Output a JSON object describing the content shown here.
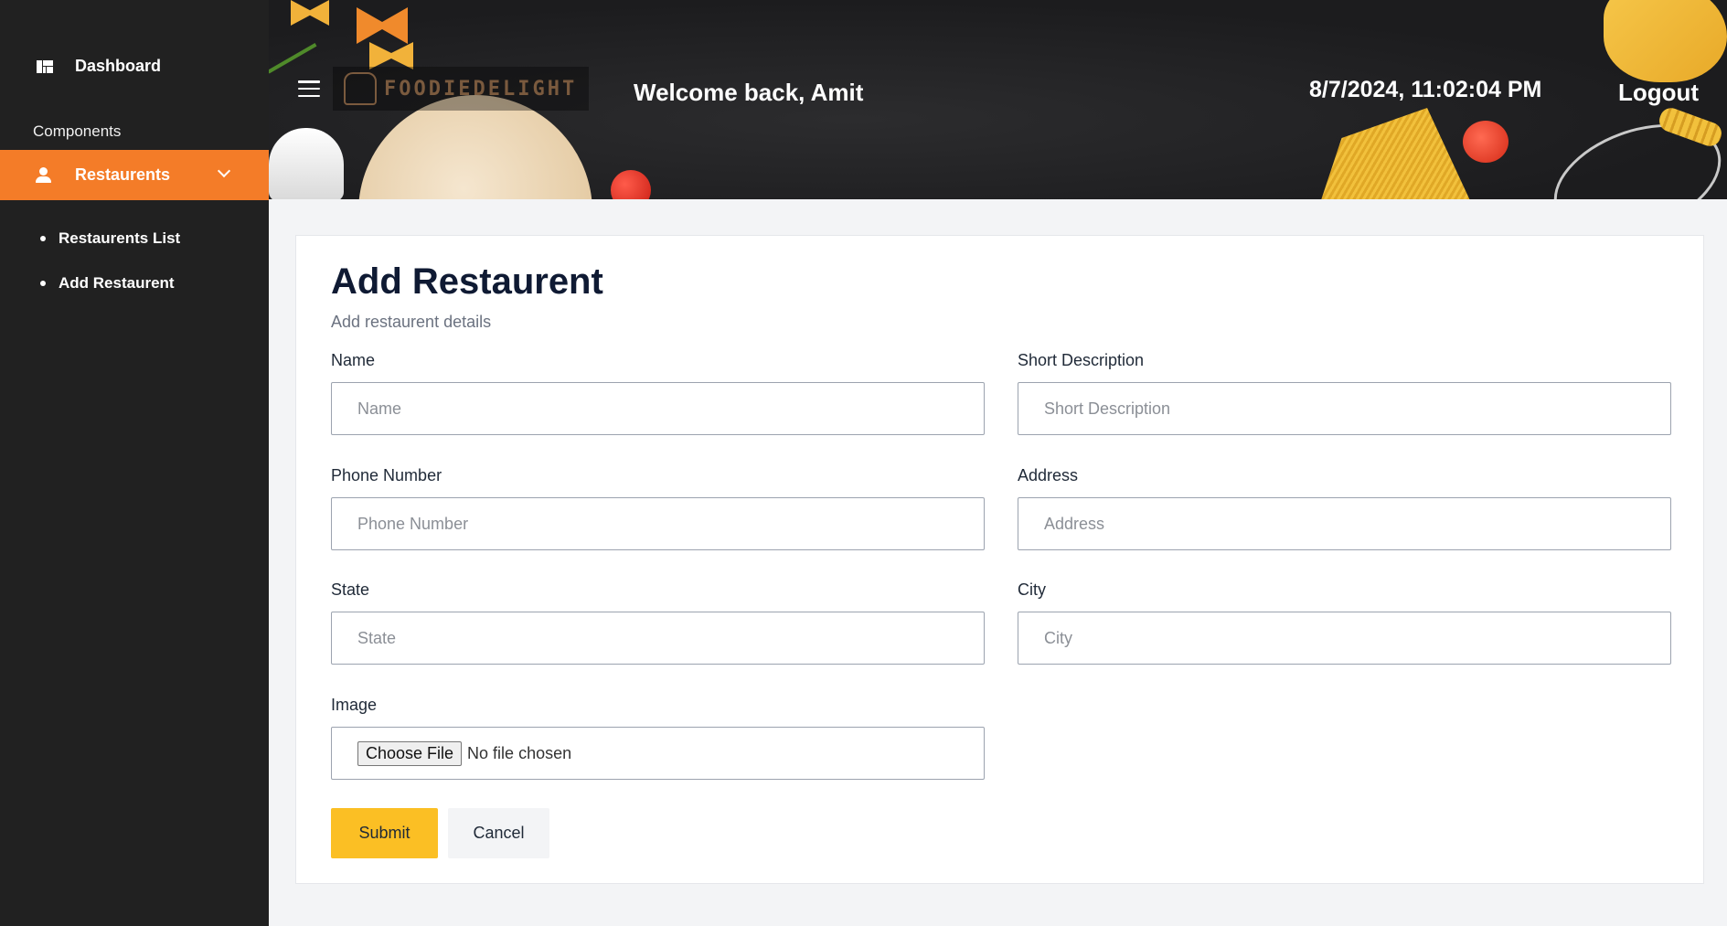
{
  "sidebar": {
    "dashboard_label": "Dashboard",
    "section_label": "Components",
    "restaurants_label": "Restaurents",
    "items": [
      {
        "label": "Restaurents List"
      },
      {
        "label": "Add Restaurent"
      }
    ],
    "active_color": "#f47c28"
  },
  "header": {
    "logo_text": "FOODIEDELIGHT",
    "welcome": "Welcome back, Amit",
    "datetime": "8/7/2024, 11:02:04 PM",
    "logout": "Logout"
  },
  "form": {
    "title": "Add Restaurent",
    "subtitle": "Add restaurent details",
    "fields": {
      "name": {
        "label": "Name",
        "placeholder": "Name"
      },
      "short_description": {
        "label": "Short Description",
        "placeholder": "Short Description"
      },
      "phone": {
        "label": "Phone Number",
        "placeholder": "Phone Number"
      },
      "address": {
        "label": "Address",
        "placeholder": "Address"
      },
      "state": {
        "label": "State",
        "placeholder": "State"
      },
      "city": {
        "label": "City",
        "placeholder": "City"
      },
      "image": {
        "label": "Image",
        "button": "Choose File",
        "status": "No file chosen"
      }
    },
    "submit_label": "Submit",
    "cancel_label": "Cancel",
    "submit_color": "#fbbf24"
  }
}
